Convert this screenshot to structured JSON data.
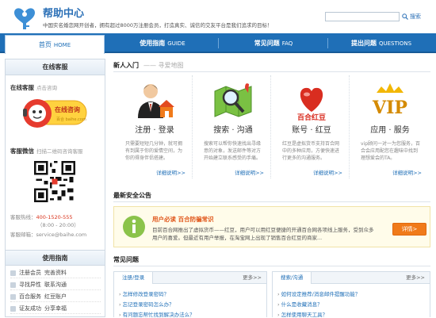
{
  "header": {
    "title": "帮助中心",
    "slogan": "中国实名婚恋网开创者，拥有超过8000万注册会员，打造真实、诚信的交友平台是我们追求的目标！",
    "search_placeholder": "",
    "search_label": "搜索"
  },
  "nav": [
    {
      "cn": "首页",
      "en": "HOME"
    },
    {
      "cn": "使用指南",
      "en": "GUIDE"
    },
    {
      "cn": "常见问题",
      "en": "FAQ"
    },
    {
      "cn": "提出问题",
      "en": "QUESTIONS"
    }
  ],
  "sidebar": {
    "online_head": "在线客服",
    "online_label": "在线客服",
    "online_hint": "点击咨询",
    "online_badge": "在线咨询",
    "online_brand": "百合 baihe.com",
    "wechat_label": "客服微信",
    "wechat_hint": "扫描二维码咨询客服",
    "hotline_label": "客服热线：",
    "hotline_number": "400-1520-555",
    "hotline_hours": "（8:00 - 20:00）",
    "email_label": "客服邮箱：",
    "email_value": "service@baihe.com",
    "guide_head": "使用指南",
    "guide_items": [
      {
        "a": "注册会员",
        "b": "完善资料"
      },
      {
        "a": "寻找异性",
        "b": "联系沟通"
      },
      {
        "a": "百合服务",
        "b": "红豆账户"
      },
      {
        "a": "证友成功",
        "b": "分享幸福"
      }
    ]
  },
  "newbie": {
    "title": "新人入门",
    "subtitle": "寻爱地图",
    "cards": [
      {
        "title": "注册 · 登录",
        "desc": "只需要短短几分钟，就可拥有到属于你的爱情空间，为你的得身伴侣搭建。",
        "more": "详细说明>>"
      },
      {
        "title": "搜索 · 沟通",
        "desc": "搜索可以帮你快速找出寻缘意的对象，发送邮件等对方开始建立联系感受的手痛。",
        "more": "详细说明>>"
      },
      {
        "title": "账号 · 红豆",
        "desc": "红豆是虚拟货币支持百合网中的多种应用，方便快速进行更多的沟通服务。",
        "more": "详细说明>>"
      },
      {
        "title": "应用 · 服务",
        "desc": "vip顾问一对一为您服务，百合会应用配您在趣味中找到理想爱会的TA。",
        "more": "详细说明>>"
      }
    ]
  },
  "security": {
    "title": "最新安全公告",
    "notice_title": "用户必读  百合防骗常识",
    "notice_text": "目前百合网推出了虚拟货币——红豆，用户可以用红豆便捷的开通百合网各项线上服务，受到众多用户的喜爱。但最近有用户举报，在淘宝网上出现了销售百合红豆的商家...",
    "notice_btn": "详情>"
  },
  "faq": {
    "title": "常见问题",
    "left_tab": "注册/登录",
    "right_tab": "搜索/沟通",
    "more": "更多>>",
    "left_items": [
      "怎样修改登录密码？",
      "忘记登录密码怎么办？",
      "有问题忘帮忙找到解决办法么？"
    ],
    "right_items": [
      "如何设定推荐/消息邮件提醒功能？",
      "什么是收藏消息？",
      "怎样使用聊天工具？"
    ]
  },
  "colors": {
    "brand": "#1f6fb7",
    "accent": "#f07a1a",
    "alert": "#d9341d"
  }
}
